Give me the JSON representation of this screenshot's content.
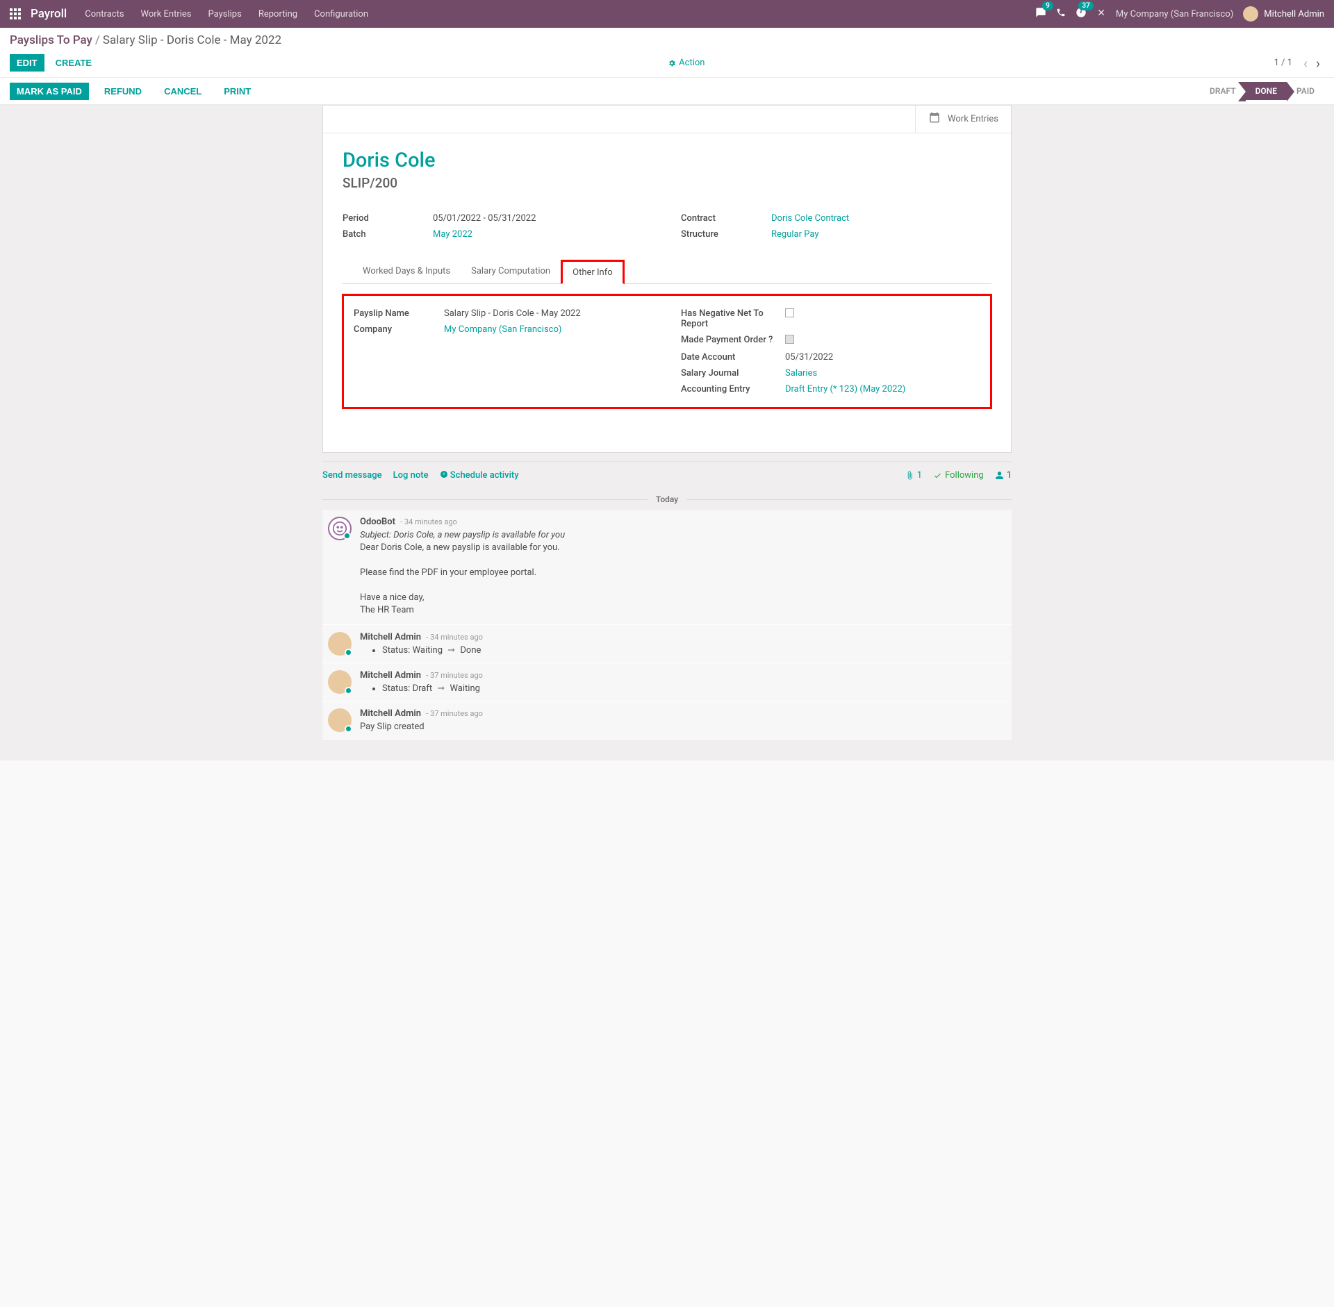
{
  "nav": {
    "brand": "Payroll",
    "links": [
      "Contracts",
      "Work Entries",
      "Payslips",
      "Reporting",
      "Configuration"
    ],
    "chat_badge": "9",
    "activity_badge": "37",
    "company": "My Company (San Francisco)",
    "user": "Mitchell Admin"
  },
  "breadcrumb": {
    "back": "Payslips To Pay",
    "current": "Salary Slip - Doris Cole - May 2022"
  },
  "controls": {
    "edit": "EDIT",
    "create": "CREATE",
    "action": "Action",
    "pager": "1 / 1"
  },
  "statusbar": {
    "mark_paid": "MARK AS PAID",
    "refund": "REFUND",
    "cancel": "CANCEL",
    "print": "PRINT",
    "steps": {
      "draft": "DRAFT",
      "done": "DONE",
      "paid": "PAID"
    }
  },
  "sheet": {
    "work_entries_btn": "Work Entries",
    "employee": "Doris Cole",
    "slip": "SLIP/200",
    "left": {
      "period_label": "Period",
      "period": "05/01/2022 - 05/31/2022",
      "batch_label": "Batch",
      "batch": "May 2022"
    },
    "right": {
      "contract_label": "Contract",
      "contract": "Doris Cole Contract",
      "structure_label": "Structure",
      "structure": "Regular Pay"
    }
  },
  "tabs": {
    "worked": "Worked Days & Inputs",
    "salary": "Salary Computation",
    "other": "Other Info"
  },
  "other_info": {
    "payslip_name_label": "Payslip Name",
    "payslip_name": "Salary Slip - Doris Cole - May 2022",
    "company_label": "Company",
    "company": "My Company (San Francisco)",
    "neg_label": "Has Negative Net To Report",
    "pay_order_label": "Made Payment Order ?",
    "date_acc_label": "Date Account",
    "date_acc": "05/31/2022",
    "journal_label": "Salary Journal",
    "journal": "Salaries",
    "entry_label": "Accounting Entry",
    "entry": "Draft Entry (* 123) (May 2022)"
  },
  "chatter": {
    "send": "Send message",
    "log": "Log note",
    "schedule": "Schedule activity",
    "attach_count": "1",
    "following": "Following",
    "followers": "1",
    "today": "Today",
    "msgs": {
      "bot": {
        "author": "OdooBot",
        "time": "- 34 minutes ago",
        "subject": "Subject: Doris Cole, a new payslip is available for you",
        "l1": "Dear Doris Cole, a new payslip is available for you.",
        "l2": "Please find the PDF in your employee portal.",
        "l3": "Have a nice day,",
        "l4": "The HR Team"
      },
      "m1": {
        "author": "Mitchell Admin",
        "time": "- 34 minutes ago",
        "prefix": "Status:",
        "from": "Waiting",
        "to": "Done"
      },
      "m2": {
        "author": "Mitchell Admin",
        "time": "- 37 minutes ago",
        "prefix": "Status:",
        "from": "Draft",
        "to": "Waiting"
      },
      "m3": {
        "author": "Mitchell Admin",
        "time": "- 37 minutes ago",
        "text": "Pay Slip created"
      }
    }
  }
}
